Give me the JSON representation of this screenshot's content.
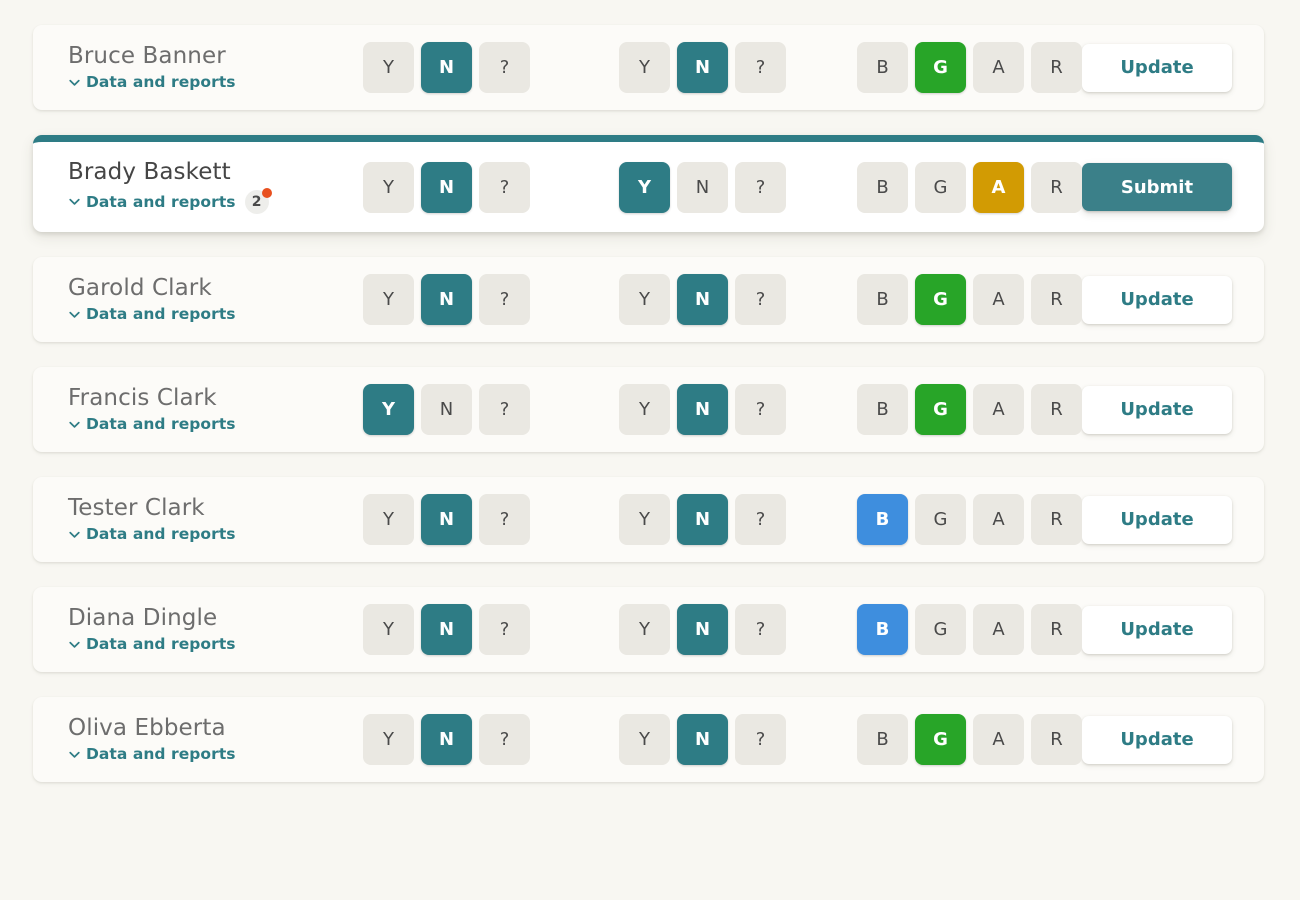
{
  "labels": {
    "reports_link": "Data and reports",
    "chevron_icon": "chevron-down-icon",
    "update_label": "Update",
    "submit_label": "Submit"
  },
  "colors": {
    "page_background": "#f8f7f2",
    "card_background": "#fcfbf8",
    "active_card_background": "#ffffff",
    "accent_teal": "#2e7c85",
    "selected_green": "#28a528",
    "selected_blue": "#3e8ede",
    "selected_amber": "#d29b03",
    "unselected_button": "#eae8e2",
    "badge_dot": "#e8501f",
    "name_text": "#6d6d6d"
  },
  "groups_meta": [
    {
      "id": "group-1",
      "options": [
        "Y",
        "N",
        "?"
      ]
    },
    {
      "id": "group-2",
      "options": [
        "Y",
        "N",
        "?"
      ]
    },
    {
      "id": "group-3",
      "options": [
        "B",
        "G",
        "A",
        "R"
      ]
    }
  ],
  "rows": [
    {
      "name": "Bruce Banner",
      "reports_link": "Data and reports",
      "badge": null,
      "active": false,
      "action": "Update",
      "group1": {
        "options": [
          "Y",
          "N",
          "?"
        ],
        "selected": "N",
        "selected_color": "teal",
        "focused": null
      },
      "group2": {
        "options": [
          "Y",
          "N",
          "?"
        ],
        "selected": "N",
        "selected_color": "teal",
        "focused": null
      },
      "group3": {
        "options": [
          "B",
          "G",
          "A",
          "R"
        ],
        "selected": "G",
        "selected_color": "green",
        "focused": null
      }
    },
    {
      "name": "Brady Baskett",
      "reports_link": "Data and reports",
      "badge": "2",
      "badge_has_dot": true,
      "active": true,
      "action": "Submit",
      "group1": {
        "options": [
          "Y",
          "N",
          "?"
        ],
        "selected": "N",
        "selected_color": "teal",
        "focused": null
      },
      "group2": {
        "options": [
          "Y",
          "N",
          "?"
        ],
        "selected": "Y",
        "selected_color": "teal",
        "focused": null
      },
      "group3": {
        "options": [
          "B",
          "G",
          "A",
          "R"
        ],
        "selected": "A",
        "selected_color": "amber",
        "focused": "B"
      }
    },
    {
      "name": "Garold Clark",
      "reports_link": "Data and reports",
      "badge": null,
      "active": false,
      "action": "Update",
      "group1": {
        "options": [
          "Y",
          "N",
          "?"
        ],
        "selected": "N",
        "selected_color": "teal",
        "focused": null
      },
      "group2": {
        "options": [
          "Y",
          "N",
          "?"
        ],
        "selected": "N",
        "selected_color": "teal",
        "focused": null
      },
      "group3": {
        "options": [
          "B",
          "G",
          "A",
          "R"
        ],
        "selected": "G",
        "selected_color": "green",
        "focused": null
      }
    },
    {
      "name": "Francis Clark",
      "reports_link": "Data and reports",
      "badge": null,
      "active": false,
      "action": "Update",
      "group1": {
        "options": [
          "Y",
          "N",
          "?"
        ],
        "selected": "Y",
        "selected_color": "teal",
        "focused": null
      },
      "group2": {
        "options": [
          "Y",
          "N",
          "?"
        ],
        "selected": "N",
        "selected_color": "teal",
        "focused": null
      },
      "group3": {
        "options": [
          "B",
          "G",
          "A",
          "R"
        ],
        "selected": "G",
        "selected_color": "green",
        "focused": null
      }
    },
    {
      "name": "Tester Clark",
      "reports_link": "Data and reports",
      "badge": null,
      "active": false,
      "action": "Update",
      "group1": {
        "options": [
          "Y",
          "N",
          "?"
        ],
        "selected": "N",
        "selected_color": "teal",
        "focused": null
      },
      "group2": {
        "options": [
          "Y",
          "N",
          "?"
        ],
        "selected": "N",
        "selected_color": "teal",
        "focused": null
      },
      "group3": {
        "options": [
          "B",
          "G",
          "A",
          "R"
        ],
        "selected": "B",
        "selected_color": "blue",
        "focused": null
      }
    },
    {
      "name": "Diana Dingle",
      "reports_link": "Data and reports",
      "badge": null,
      "active": false,
      "action": "Update",
      "group1": {
        "options": [
          "Y",
          "N",
          "?"
        ],
        "selected": "N",
        "selected_color": "teal",
        "focused": null
      },
      "group2": {
        "options": [
          "Y",
          "N",
          "?"
        ],
        "selected": "N",
        "selected_color": "teal",
        "focused": null
      },
      "group3": {
        "options": [
          "B",
          "G",
          "A",
          "R"
        ],
        "selected": "B",
        "selected_color": "blue",
        "focused": null
      }
    },
    {
      "name": "Oliva Ebberta",
      "reports_link": "Data and reports",
      "badge": null,
      "active": false,
      "action": "Update",
      "group1": {
        "options": [
          "Y",
          "N",
          "?"
        ],
        "selected": "N",
        "selected_color": "teal",
        "focused": null
      },
      "group2": {
        "options": [
          "Y",
          "N",
          "?"
        ],
        "selected": "N",
        "selected_color": "teal",
        "focused": null
      },
      "group3": {
        "options": [
          "B",
          "G",
          "A",
          "R"
        ],
        "selected": "G",
        "selected_color": "green",
        "focused": null
      }
    }
  ]
}
